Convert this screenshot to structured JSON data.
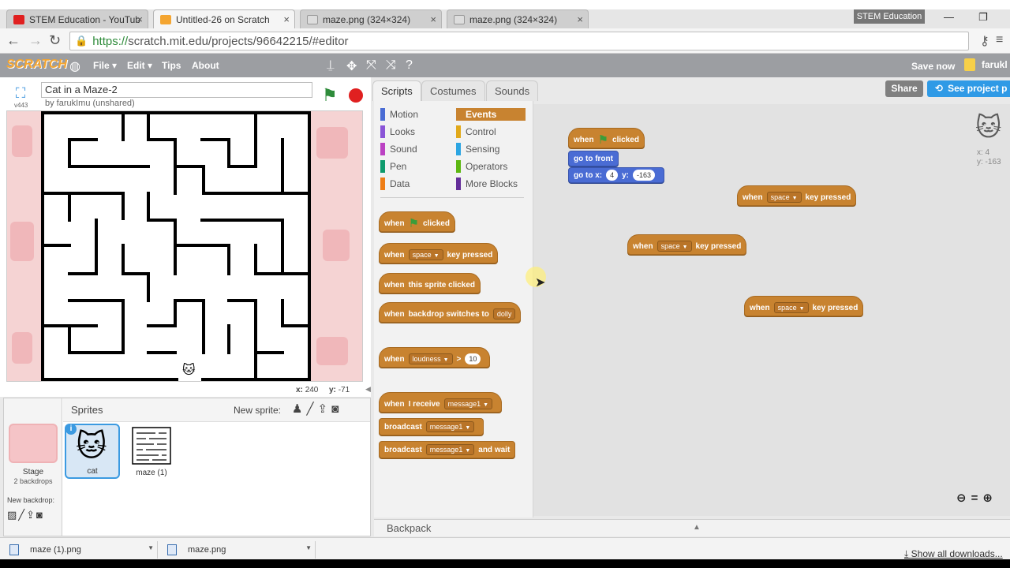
{
  "browser": {
    "tabs": [
      {
        "label": "STEM Education - YouTub",
        "color": "#e02020"
      },
      {
        "label": "Untitled-26 on Scratch",
        "color": "#f4a531"
      },
      {
        "label": "maze.png (324×324)",
        "color": "#cccccc"
      },
      {
        "label": "maze.png (324×324)",
        "color": "#cccccc"
      }
    ],
    "close_glyph": "×",
    "user_chip": "STEM Education",
    "url_https": "https://",
    "url_rest": "scratch.mit.edu/projects/96642215/#editor"
  },
  "scratch_menu": {
    "logo": "SCRATCH",
    "file": "File ▾",
    "edit": "Edit ▾",
    "tips": "Tips",
    "about": "About",
    "save_now": "Save now",
    "username": "farukl"
  },
  "project": {
    "title": "Cat in a Maze-2",
    "by": "by farukImu (unshared)",
    "version": "v443"
  },
  "stage": {
    "x_label": "x:",
    "x_value": "240",
    "y_label": "y:",
    "y_value": "-71"
  },
  "sprites": {
    "header": "Sprites",
    "new_sprite": "New sprite:",
    "stage_label": "Stage",
    "backdrop_count": "2 backdrops",
    "new_backdrop": "New backdrop:",
    "items": [
      {
        "name": "cat"
      },
      {
        "name": "maze (1)"
      }
    ]
  },
  "palette": {
    "tabs": [
      "Scripts",
      "Costumes",
      "Sounds"
    ],
    "categories_left": [
      {
        "label": "Motion",
        "color": "#4a6cd4"
      },
      {
        "label": "Looks",
        "color": "#8a55d7"
      },
      {
        "label": "Sound",
        "color": "#bb42c3"
      },
      {
        "label": "Pen",
        "color": "#0e9a6c"
      },
      {
        "label": "Data",
        "color": "#ee7d16"
      }
    ],
    "categories_right": [
      {
        "label": "Events",
        "color": "#c88330"
      },
      {
        "label": "Control",
        "color": "#e1a91a"
      },
      {
        "label": "Sensing",
        "color": "#2ca5e2"
      },
      {
        "label": "Operators",
        "color": "#5cb712"
      },
      {
        "label": "More Blocks",
        "color": "#632d99"
      }
    ],
    "blocks": {
      "when": "when",
      "clicked": "clicked",
      "key_pressed": "key pressed",
      "space": "space",
      "this_sprite_clicked": "this sprite clicked",
      "backdrop_switches": "backdrop switches to",
      "dolly": "dolly",
      "loudness": "loudness",
      "gt": ">",
      "ten": "10",
      "i_receive": "I receive",
      "message1": "message1",
      "broadcast": "broadcast",
      "and_wait": "and wait"
    }
  },
  "scripts": {
    "go_to_front": "go to front",
    "go_to_x": "go to x:",
    "x_val": "4",
    "y_label": "y:",
    "y_val": "-163"
  },
  "sprite_info": {
    "x": "x: 4",
    "y": "y: -163"
  },
  "buttons": {
    "share": "Share",
    "see_project": "See project p"
  },
  "backpack": {
    "label": "Backpack"
  },
  "downloads": {
    "items": [
      "maze (1).png",
      "maze.png"
    ],
    "show_all": "Show all downloads..."
  }
}
